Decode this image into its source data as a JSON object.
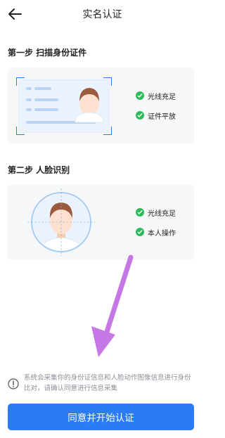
{
  "header": {
    "title": "实名认证",
    "back_icon": "back-arrow-icon"
  },
  "step1": {
    "title": "第一步 扫描身份证件",
    "checks": [
      "光线充足",
      "证件平放"
    ]
  },
  "step2": {
    "title": "第二步 人脸识别",
    "checks": [
      "光线充足",
      "本人操作"
    ]
  },
  "notice": {
    "icon": "info-icon",
    "text": "系统会采集你的身份证信息和人脸动作图像信息进行身份比对，请确认同意进行信息采集"
  },
  "cta": {
    "label": "同意并开始认证"
  },
  "colors": {
    "primary": "#2b7cf2",
    "check": "#2bbb5b",
    "card": "#f6f7f9",
    "annotation_arrow": "#c577e6"
  }
}
